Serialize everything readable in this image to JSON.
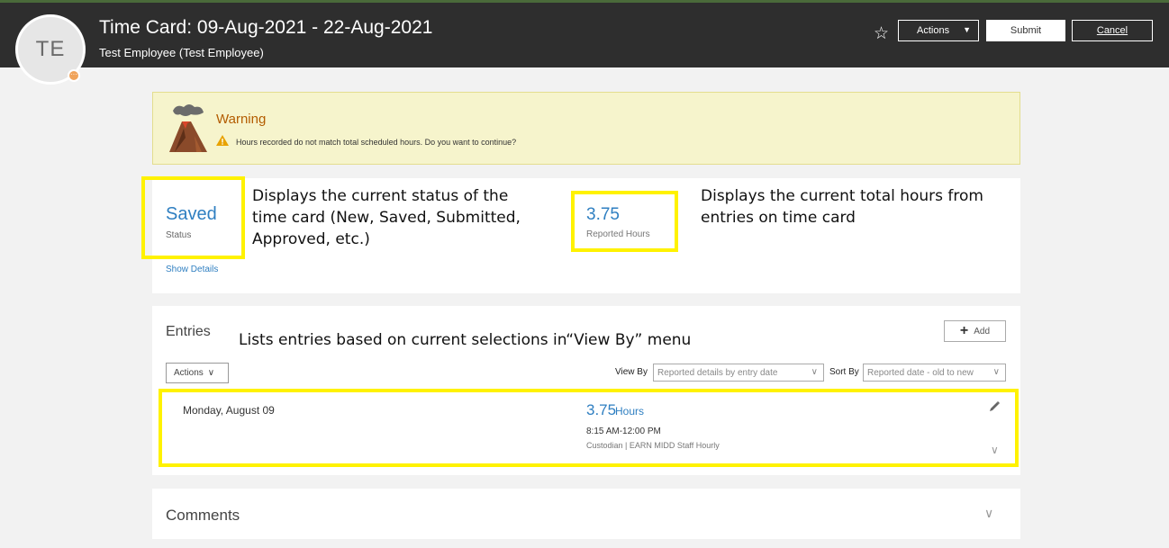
{
  "header": {
    "title": "Time Card: 09-Aug-2021 - 22-Aug-2021",
    "subtitle": "Test Employee (Test Employee)",
    "avatar_initials": "TE",
    "avatar_badge": "···",
    "actions_label": "Actions",
    "submit_label": "Submit",
    "cancel_label": "Cancel"
  },
  "warning": {
    "title": "Warning",
    "message": "Hours recorded do not match total scheduled hours. Do you want to continue?"
  },
  "summary": {
    "status_value": "Saved",
    "status_label": "Status",
    "show_details": "Show Details",
    "hours_value": "3.75",
    "hours_label": "Reported Hours"
  },
  "annotations": {
    "status_note": "Displays the current status of the time card (New, Saved, Submitted, Approved, etc.)",
    "hours_note": "Displays the current total hours from entries on time card",
    "entries_note": "Lists entries based on current selections in“View By” menu"
  },
  "entries": {
    "title": "Entries",
    "add_label": "Add",
    "actions_label": "Actions",
    "view_by_label": "View By",
    "view_by_value": "Reported details by entry date",
    "sort_by_label": "Sort By",
    "sort_by_value": "Reported date - old to new",
    "items": [
      {
        "date": "Monday, August 09",
        "hours": "3.75",
        "hours_unit": "Hours",
        "time_range": "8:15 AM-12:00 PM",
        "description": "Custodian | EARN MIDD Staff Hourly"
      }
    ]
  },
  "comments": {
    "title": "Comments"
  },
  "colors": {
    "header_bg": "#2e2e2e",
    "accent_blue": "#2f7fc1",
    "highlight_yellow": "#fff200",
    "warning_bg": "#f6f4cc",
    "warning_title": "#b35c00"
  }
}
